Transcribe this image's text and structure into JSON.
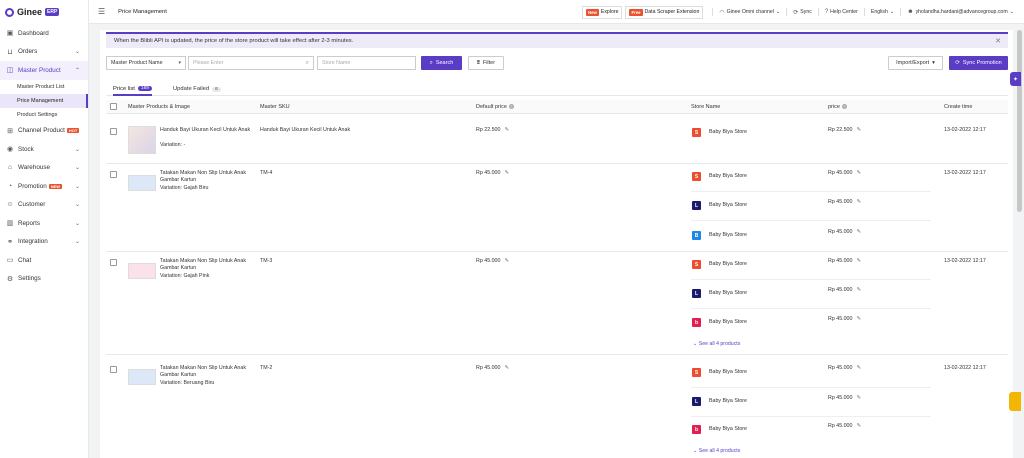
{
  "brand": {
    "name": "Ginee",
    "badge": "ERP"
  },
  "sidebar": {
    "items": [
      {
        "label": "Dashboard",
        "icon": "dashboard-icon"
      },
      {
        "label": "Orders",
        "icon": "cart-icon"
      },
      {
        "label": "Master Product",
        "icon": "box-icon"
      },
      {
        "label": "Channel Product",
        "icon": "channel-icon",
        "badge": "HOT"
      },
      {
        "label": "Stock",
        "icon": "stock-icon"
      },
      {
        "label": "Warehouse",
        "icon": "warehouse-icon"
      },
      {
        "label": "Promotion",
        "icon": "promotion-icon",
        "badge": "NEW"
      },
      {
        "label": "Customer",
        "icon": "customer-icon"
      },
      {
        "label": "Reports",
        "icon": "reports-icon"
      },
      {
        "label": "Integration",
        "icon": "integration-icon"
      },
      {
        "label": "Chat",
        "icon": "chat-icon"
      },
      {
        "label": "Settings",
        "icon": "gear-icon"
      }
    ],
    "sub_items": [
      "Master Product List",
      "Price Management",
      "Product Settings"
    ]
  },
  "topbar": {
    "title": "Price Management",
    "explore_badge": "New",
    "explore_label": "Explore",
    "ext_badge": "Free",
    "ext_label": "Data Scraper Extension",
    "channel": "Ginee Omni channel",
    "sync": "Sync",
    "help": "Help Center",
    "language": "English",
    "user": "yholandha.hardani@advancegroup.com"
  },
  "notice": {
    "text": "When the Blibli API is updated, the price of the store product will take effect after 2-3 minutes."
  },
  "filters": {
    "field_select": "Master Product Name",
    "search_placeholder": "Please Enter",
    "store_placeholder": "Store Name",
    "search_btn": "Search",
    "filter_btn": "Filter",
    "import_export": "Import/Export",
    "sync_promotion": "Sync Promotion"
  },
  "tabs": [
    {
      "label": "Price list",
      "count": "169"
    },
    {
      "label": "Update Failed",
      "count": "6"
    }
  ],
  "table": {
    "headers": {
      "product": "Master Products & Image",
      "sku": "Master SKU",
      "default_price": "Default price",
      "store": "Store Name",
      "price": "price",
      "create_time": "Create time"
    },
    "rows": [
      {
        "name": "Handuk Bayi Ukuran Kecil Untuk Anak",
        "variation": "Variation: -",
        "sku": "Handuk Bayi Ukuran Kecil Untuk Anak",
        "default_price": "Rp 22.500",
        "stores": [
          {
            "name": "Baby Biya Store",
            "price": "Rp 22.500",
            "time": "13-02-2022 12:17",
            "channel": "shopee"
          }
        ]
      },
      {
        "name": "Tatakan Makan Non Slip Untuk Anak Gambar Kartun",
        "variation": "Variation: Gajah Biru",
        "sku": "TM-4",
        "default_price": "Rp 45.000",
        "stores": [
          {
            "name": "Baby Biya Store",
            "price": "Rp 45.000",
            "time": "13-02-2022 12:17",
            "channel": "shopee"
          },
          {
            "name": "Baby Biya Store",
            "price": "Rp 45.000",
            "channel": "lazada"
          },
          {
            "name": "Baby Biya Store",
            "price": "Rp 45.000",
            "channel": "blibli"
          }
        ]
      },
      {
        "name": "Tatakan Makan Non Slip Untuk Anak Gambar Kartun",
        "variation": "Variation: Gajah Pink",
        "sku": "TM-3",
        "default_price": "Rp 45.000",
        "stores": [
          {
            "name": "Baby Biya Store",
            "price": "Rp 45.000",
            "time": "13-02-2022 12:17",
            "channel": "shopee"
          },
          {
            "name": "Baby Biya Store",
            "price": "Rp 45.000",
            "channel": "lazada"
          },
          {
            "name": "Baby Biya Store",
            "price": "Rp 45.000",
            "channel": "bukalapak"
          }
        ],
        "see_all": "See all 4 products"
      },
      {
        "name": "Tatakan Makan Non Slip Untuk Anak Gambar Kartun",
        "variation": "Variation: Beruang Biru",
        "sku": "TM-2",
        "default_price": "Rp 45.000",
        "stores": [
          {
            "name": "Baby Biya Store",
            "price": "Rp 45.000",
            "time": "13-02-2022 12:17",
            "channel": "shopee"
          },
          {
            "name": "Baby Biya Store",
            "price": "Rp 45.000",
            "channel": "lazada"
          },
          {
            "name": "Baby Biya Store",
            "price": "Rp 45.000",
            "channel": "bukalapak"
          }
        ],
        "see_all": "See all 4 products"
      }
    ]
  },
  "colors": {
    "accent": "#5b3cc4",
    "shopee": "#ee4d2d",
    "lazada": "#1a1b6e",
    "bukalapak": "#e31e52",
    "blibli": "#1e88e5"
  }
}
